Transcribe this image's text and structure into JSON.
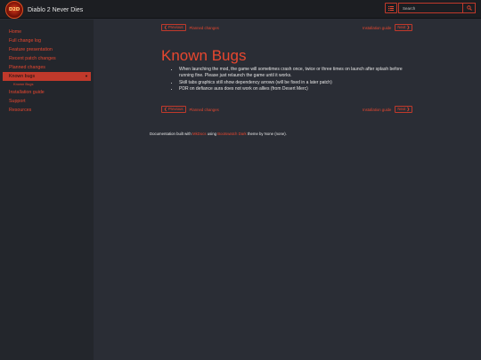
{
  "header": {
    "logo_text": "D2D",
    "title": "Diablo 2 Never Dies",
    "search_placeholder": "Search"
  },
  "sidebar": {
    "items": [
      {
        "label": "Home"
      },
      {
        "label": "Full change log"
      },
      {
        "label": "Feature presentation"
      },
      {
        "label": "Recent patch changes"
      },
      {
        "label": "Planned changes"
      },
      {
        "label": "Known bugs",
        "active": true
      },
      {
        "label": "Installation guide"
      },
      {
        "label": "Support"
      },
      {
        "label": "Resources"
      }
    ],
    "subitem": "Known Bugs"
  },
  "pager": {
    "previous_label": "Previous",
    "previous_title": "Planned changes",
    "next_title": "Installation guide",
    "next_label": "Next"
  },
  "main": {
    "title": "Known Bugs",
    "bugs": [
      "When launching the mod, the game will sometimes crash once, twice or three times on launch after splash before running fine. Please just relaunch the game until it works.",
      "Skill tabs graphics still show dependency arrows (will be fixed in a later patch)",
      "PDR on defiance aura does not work on allies (from Desert Merc)"
    ]
  },
  "footer": {
    "prefix": "Documentation built with ",
    "mkdocs": "MkDocs",
    "middle": " using ",
    "theme": "Bootswatch Dark",
    "suffix": " theme by None (none)."
  },
  "colors": {
    "accent": "#e8472f",
    "active_bg": "#c0392b",
    "page_bg": "#2a2d35",
    "sidebar_bg": "#23262c",
    "navbar_bg": "#1c1e22"
  },
  "icons": {
    "menu": "list-icon",
    "search": "search-icon",
    "previous": "chevron-left-icon",
    "next": "chevron-right-icon",
    "active_caret": "caret-down-icon"
  }
}
